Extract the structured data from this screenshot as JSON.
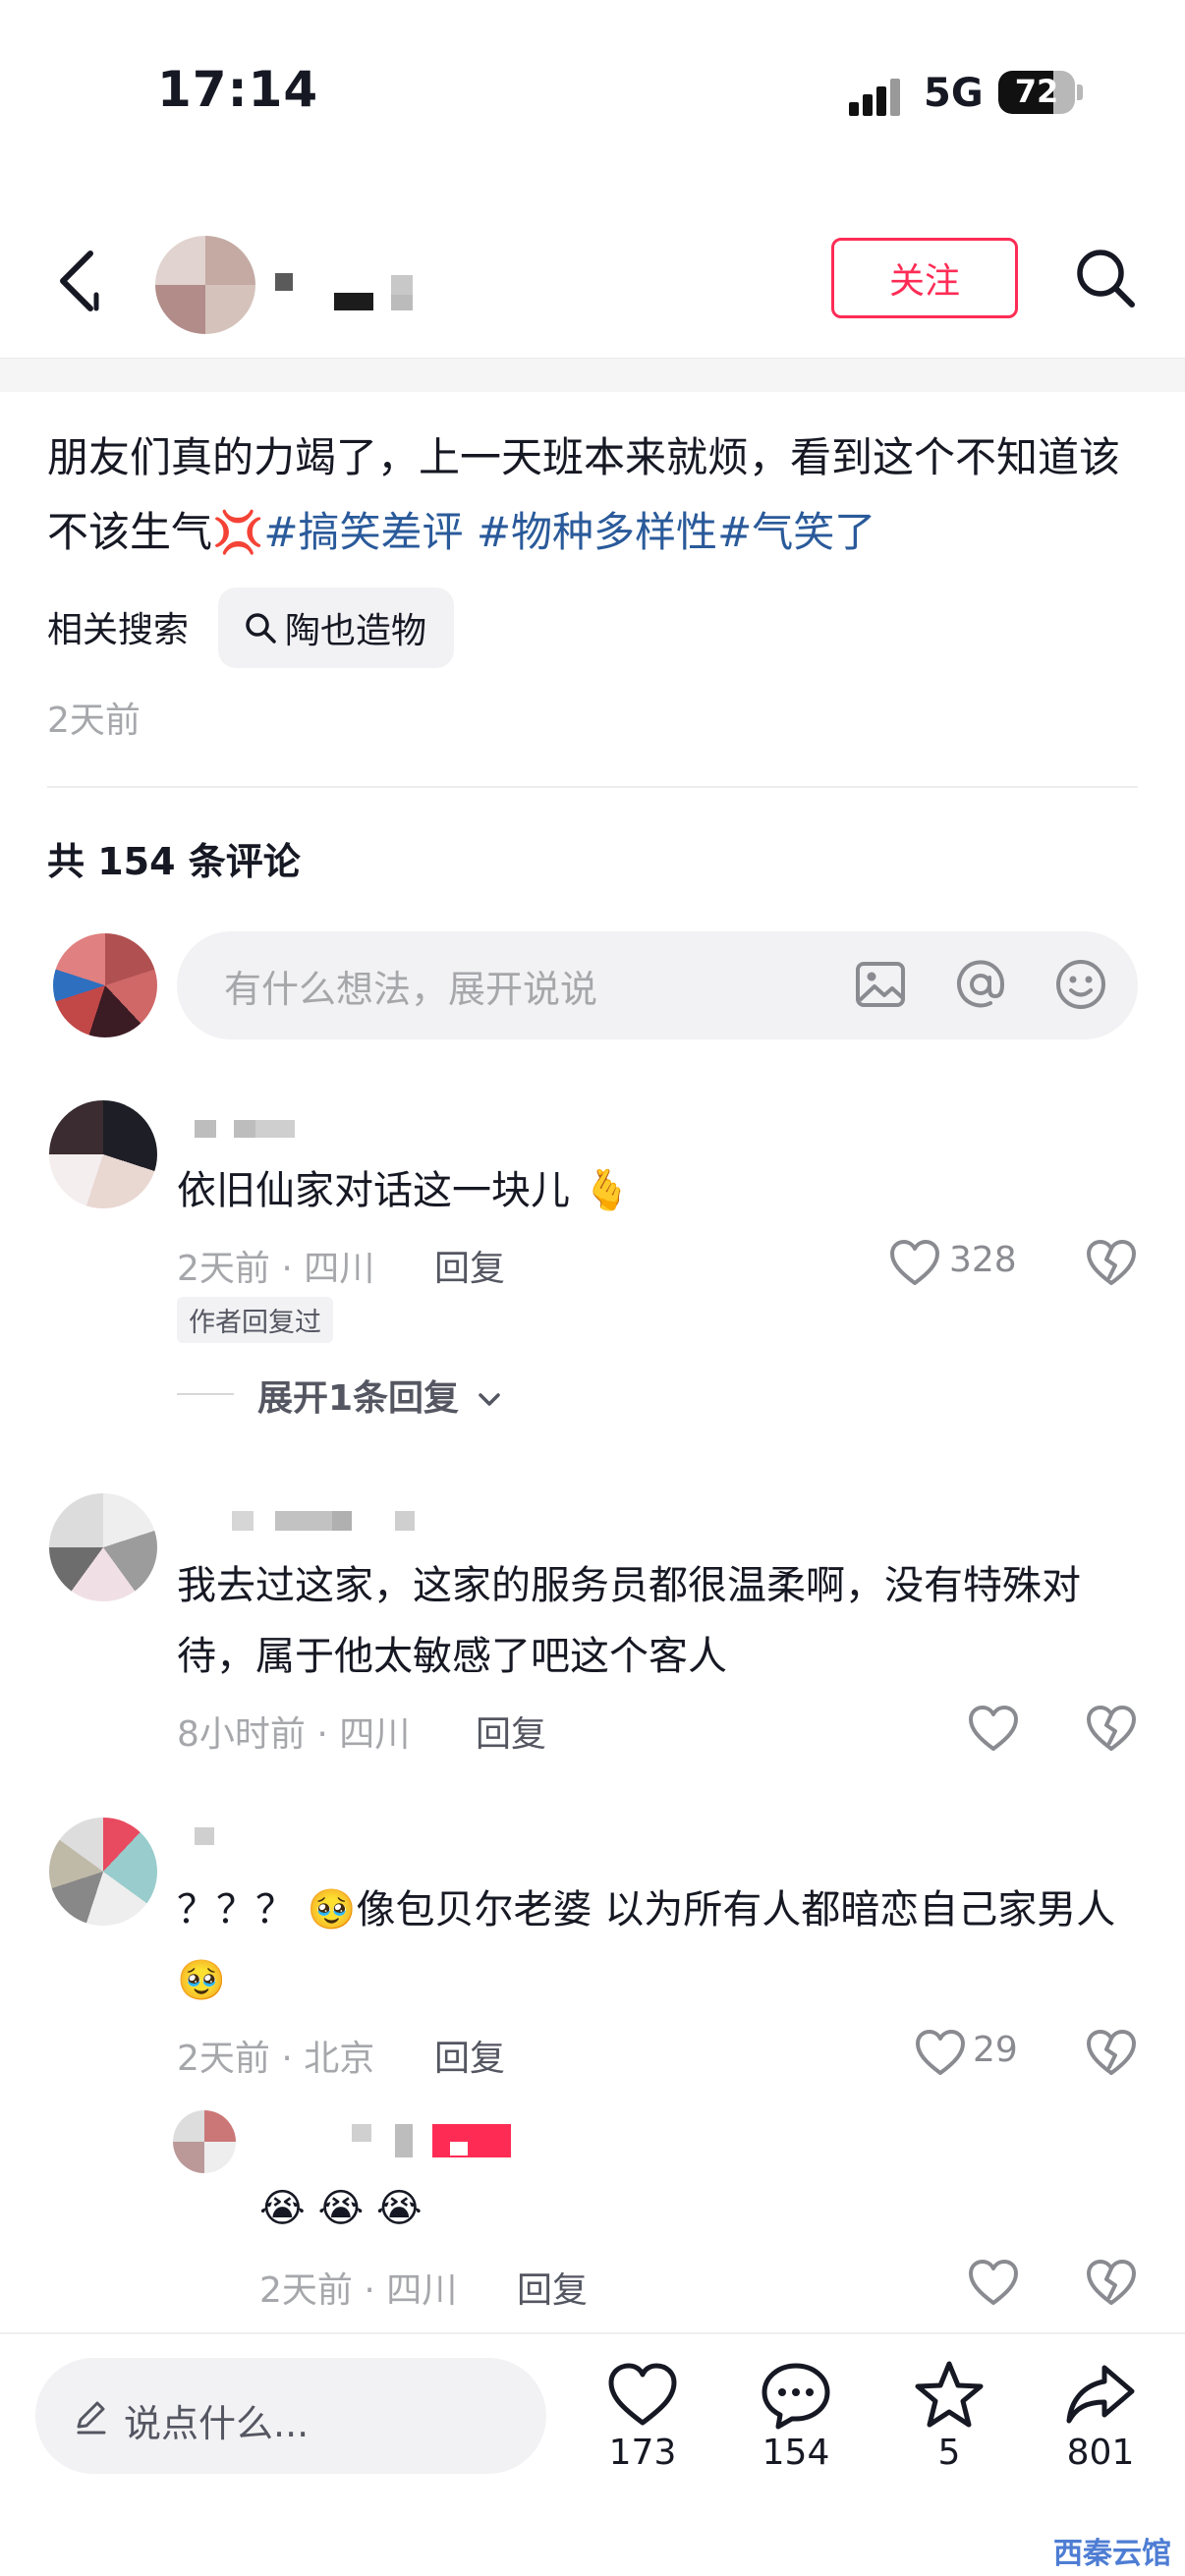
{
  "status_bar": {
    "time": "17:14",
    "network": "5G",
    "battery": "72",
    "battery_level": 0.72
  },
  "header": {
    "follow_label": "关注"
  },
  "post": {
    "caption_text": "朋友们真的力竭了，上一天班本来就烦，看到这个不知道该不该生气",
    "caption_emoji": "💢",
    "tags": [
      "#搞笑差评",
      " #物种多样性",
      "#气笑了"
    ],
    "related_label": "相关搜索",
    "related_query": "陶也造物",
    "time": "2天前"
  },
  "comments_header": "共 154 条评论",
  "comment_input": {
    "placeholder": "有什么想法，展开说说"
  },
  "comments": [
    {
      "text": "依旧仙家对话这一块儿 🫰",
      "meta": "2天前 · 四川",
      "reply": "回复",
      "likes": "328",
      "badge": "作者回复过",
      "expand": "展开1条回复"
    },
    {
      "text": "我去过这家，这家的服务员都很温柔啊，没有特殊对待，属于他太敏感了吧这个客人",
      "meta": "8小时前 · 四川",
      "reply": "回复",
      "likes": ""
    },
    {
      "text": "？？？ 🥹像包贝尔老婆 以为所有人都暗恋自己家男人🥹",
      "meta": "2天前 · 北京",
      "reply": "回复",
      "likes": "29"
    },
    {
      "text": "😭 😭 😭",
      "meta": "2天前 · 四川",
      "reply": "回复",
      "likes": ""
    }
  ],
  "bottom_bar": {
    "placeholder": "说点什么...",
    "like_count": "173",
    "comment_count": "154",
    "star_count": "5",
    "share_count": "801"
  },
  "watermark": "西秦云馆",
  "icons": [
    "back-icon",
    "search-icon",
    "magnify-icon",
    "image-icon",
    "at-icon",
    "emoji-icon",
    "heart-icon",
    "broken-heart-icon",
    "chevron-down-icon",
    "pencil-icon",
    "comment-icon",
    "star-icon",
    "share-icon"
  ]
}
